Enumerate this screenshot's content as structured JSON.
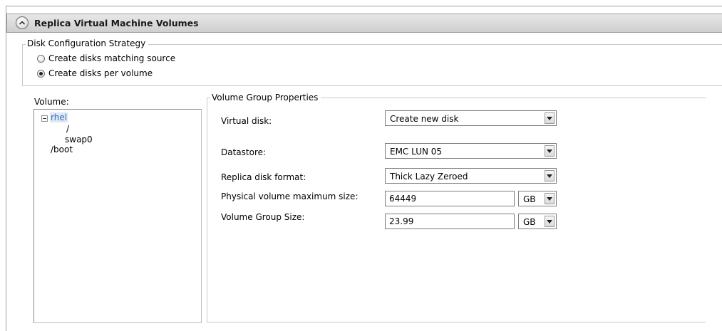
{
  "section": {
    "title": "Replica Virtual Machine Volumes"
  },
  "disk_strategy": {
    "legend": "Disk Configuration Strategy",
    "options": [
      {
        "label": "Create disks matching source",
        "checked": false
      },
      {
        "label": "Create disks per volume",
        "checked": true
      }
    ]
  },
  "volume": {
    "label": "Volume:",
    "tree": {
      "root": "rhel",
      "children": [
        "/",
        "swap0"
      ],
      "sibling": "/boot"
    }
  },
  "vg_props": {
    "legend": "Volume Group Properties",
    "virtual_disk": {
      "label": "Virtual disk:",
      "value": "Create new disk"
    },
    "datastore": {
      "label": "Datastore:",
      "value": "EMC LUN 05"
    },
    "replica_format": {
      "label": "Replica disk format:",
      "value": "Thick Lazy Zeroed"
    },
    "pv_max": {
      "label": "Physical volume maximum size:",
      "value": "64449",
      "unit": "GB"
    },
    "vg_size": {
      "label": "Volume Group Size:",
      "value": "23.99",
      "unit": "GB"
    }
  },
  "icons": {
    "collapse": "chevron-up-icon",
    "tree_toggle": "minus-box-icon"
  }
}
